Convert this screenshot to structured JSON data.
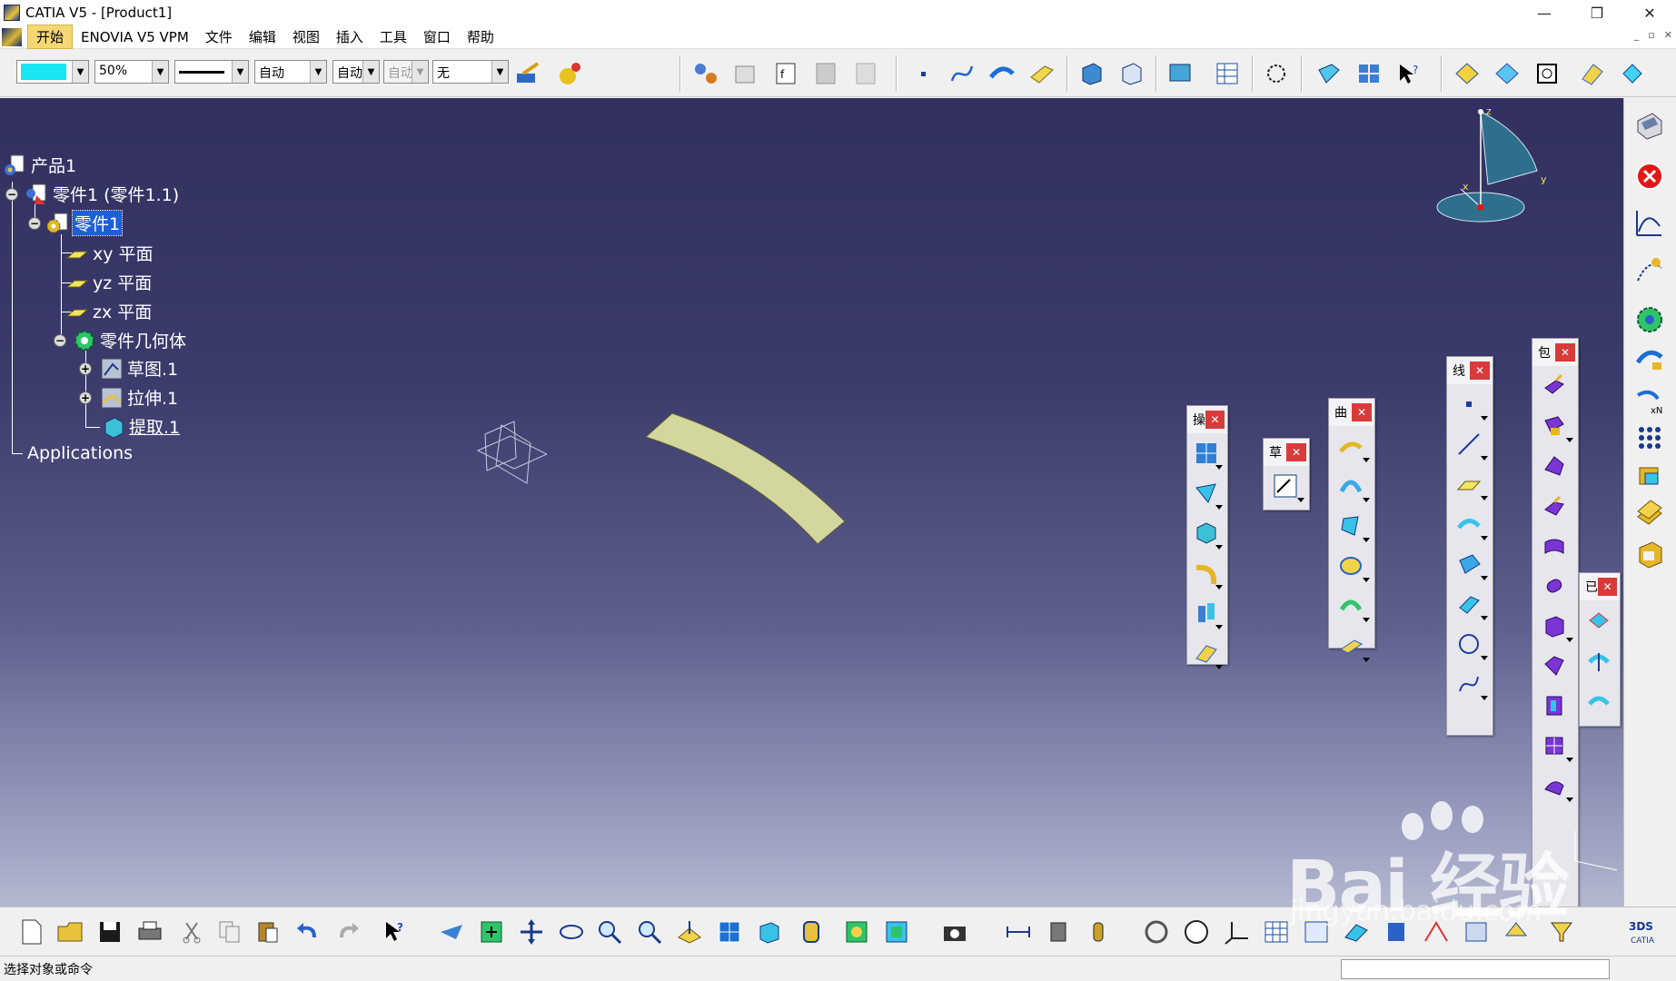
{
  "window": {
    "title": "CATIA V5 - [Product1]",
    "controls": [
      "—",
      "❐",
      "✕"
    ]
  },
  "menubar": {
    "items": [
      "开始",
      "ENOVIA V5 VPM",
      "文件",
      "编辑",
      "视图",
      "插入",
      "工具",
      "窗口",
      "帮助"
    ],
    "active_index": 0,
    "doc_controls": [
      "_",
      "▫",
      "✕"
    ]
  },
  "toolbar": {
    "color_swatch": "#18e6f2",
    "transparency": "50%",
    "linetype": "——————",
    "thickness": "自动",
    "point_style": "自动",
    "layer_style": "自动",
    "layer": "无"
  },
  "tree": {
    "root": "产品1",
    "part_instance": "零件1 (零件1.1)",
    "part": "零件1",
    "planes": [
      "xy 平面",
      "yz 平面",
      "zx 平面"
    ],
    "body": "零件几何体",
    "features": [
      "草图.1",
      "拉伸.1",
      "提取.1"
    ],
    "applications": "Applications"
  },
  "palettes": [
    {
      "title": "操",
      "icon_names": [
        "multi-section-icon",
        "sweep-icon",
        "extract-icon",
        "fillet-icon",
        "translate-icon",
        "extrapolate-icon"
      ]
    },
    {
      "title": "草",
      "icon_names": [
        "sketch-icon"
      ]
    },
    {
      "title": "曲",
      "icon_names": [
        "extrude-surface-icon",
        "revolve-surface-icon",
        "sphere-surface-icon",
        "fill-icon",
        "blend-icon",
        "offset-icon"
      ]
    },
    {
      "title": "线",
      "icon_names": [
        "point-icon",
        "line-icon",
        "plane-icon",
        "projection-icon",
        "intersection-icon",
        "parallel-curve-icon",
        "circle-icon",
        "spline-icon"
      ]
    },
    {
      "title": "包",
      "icon_names": [
        "pad-icon",
        "pocket-icon",
        "shaft-icon",
        "groove-icon",
        "rib-icon",
        "slot-icon",
        "stiffener-icon",
        "loft-icon",
        "removed-loft-icon",
        "thick-surface-icon",
        "close-surface-icon"
      ]
    },
    {
      "title": "已",
      "icon_names": [
        "sew-surface-icon",
        "split-icon",
        "thickness-icon"
      ]
    }
  ],
  "compass_axes": {
    "z": "z",
    "y": "y",
    "x": "x"
  },
  "status": {
    "message": "选择对象或命令"
  },
  "watermark": {
    "brand": "Bai 经验",
    "url": "jingyan.baidu.com"
  },
  "colors": {
    "viewport_top": "#31305f",
    "viewport_bottom": "#b4b8cf",
    "surface_fill": "#d3d79e",
    "tree_text": "#ffffff",
    "selection": "#1d5fd8"
  }
}
